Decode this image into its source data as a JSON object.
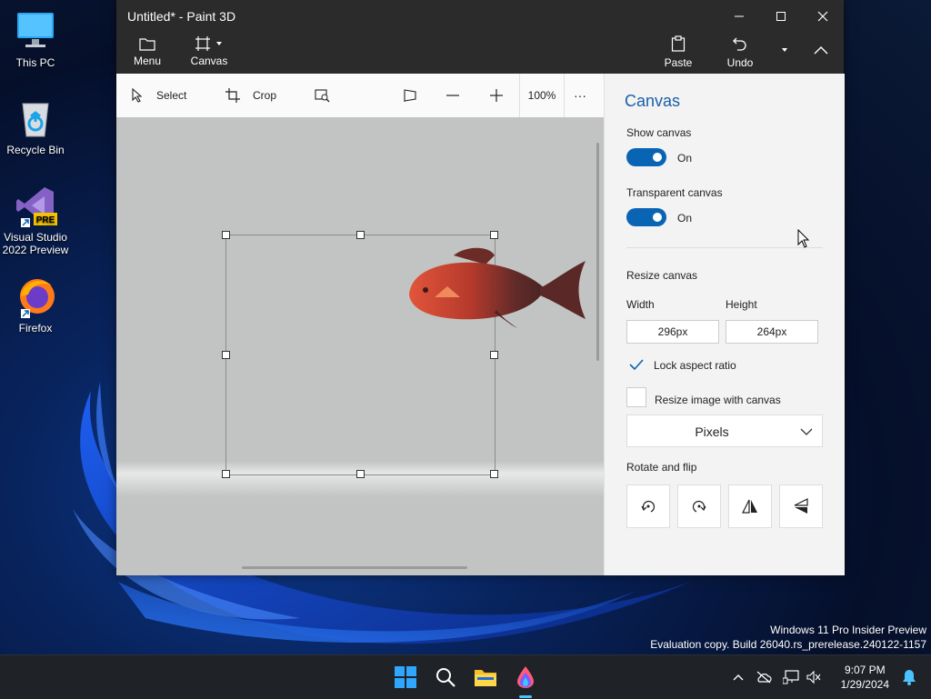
{
  "desktop": {
    "icons": [
      {
        "label": "This PC"
      },
      {
        "label": "Recycle Bin"
      },
      {
        "label": "Visual Studio 2022 Preview",
        "badge": "PRE"
      },
      {
        "label": "Firefox"
      }
    ],
    "watermark": {
      "line1": "Windows 11 Pro Insider Preview",
      "line2": "Evaluation copy. Build 26040.rs_prerelease.240122-1157"
    }
  },
  "window": {
    "title": "Untitled* - Paint 3D",
    "top_buttons": {
      "menu": "Menu",
      "canvas": "Canvas",
      "paste": "Paste",
      "undo": "Undo"
    },
    "toolbar": {
      "select": "Select",
      "crop": "Crop",
      "zoom": "100%",
      "more": "···"
    }
  },
  "panel": {
    "title": "Canvas",
    "show_canvas": {
      "label": "Show canvas",
      "state": "On"
    },
    "transparent_canvas": {
      "label": "Transparent canvas",
      "state": "On"
    },
    "resize": {
      "label": "Resize canvas",
      "width_label": "Width",
      "height_label": "Height",
      "width_value": "296px",
      "height_value": "264px",
      "lock_aspect": {
        "label": "Lock aspect ratio",
        "checked": true
      },
      "resize_image": {
        "label": "Resize image with canvas",
        "checked": false
      },
      "unit": "Pixels"
    },
    "rotate_flip": {
      "label": "Rotate and flip"
    }
  },
  "taskbar": {
    "time": "9:07 PM",
    "date": "1/29/2024"
  },
  "colors": {
    "accent": "#0a64b4",
    "panel_title": "#1b5fa6",
    "titlebar": "#2b2b2b"
  }
}
